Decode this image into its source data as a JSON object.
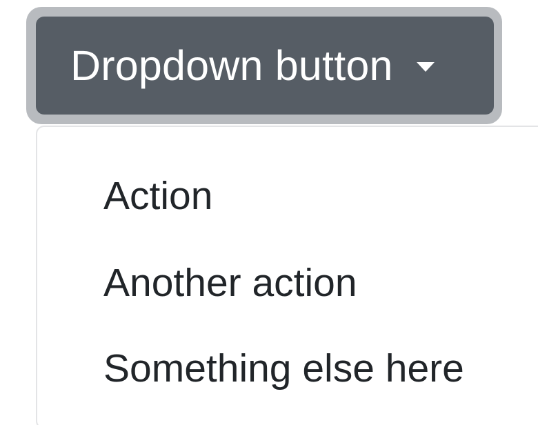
{
  "dropdown": {
    "button_label": "Dropdown button",
    "caret_icon": "caret-down-icon",
    "items": [
      {
        "label": "Action"
      },
      {
        "label": "Another action"
      },
      {
        "label": "Something else here"
      }
    ]
  },
  "colors": {
    "button_bg": "#565d65",
    "focus_ring": "#b8bbbf",
    "menu_border": "#e3e4e6",
    "item_text": "#212529"
  }
}
